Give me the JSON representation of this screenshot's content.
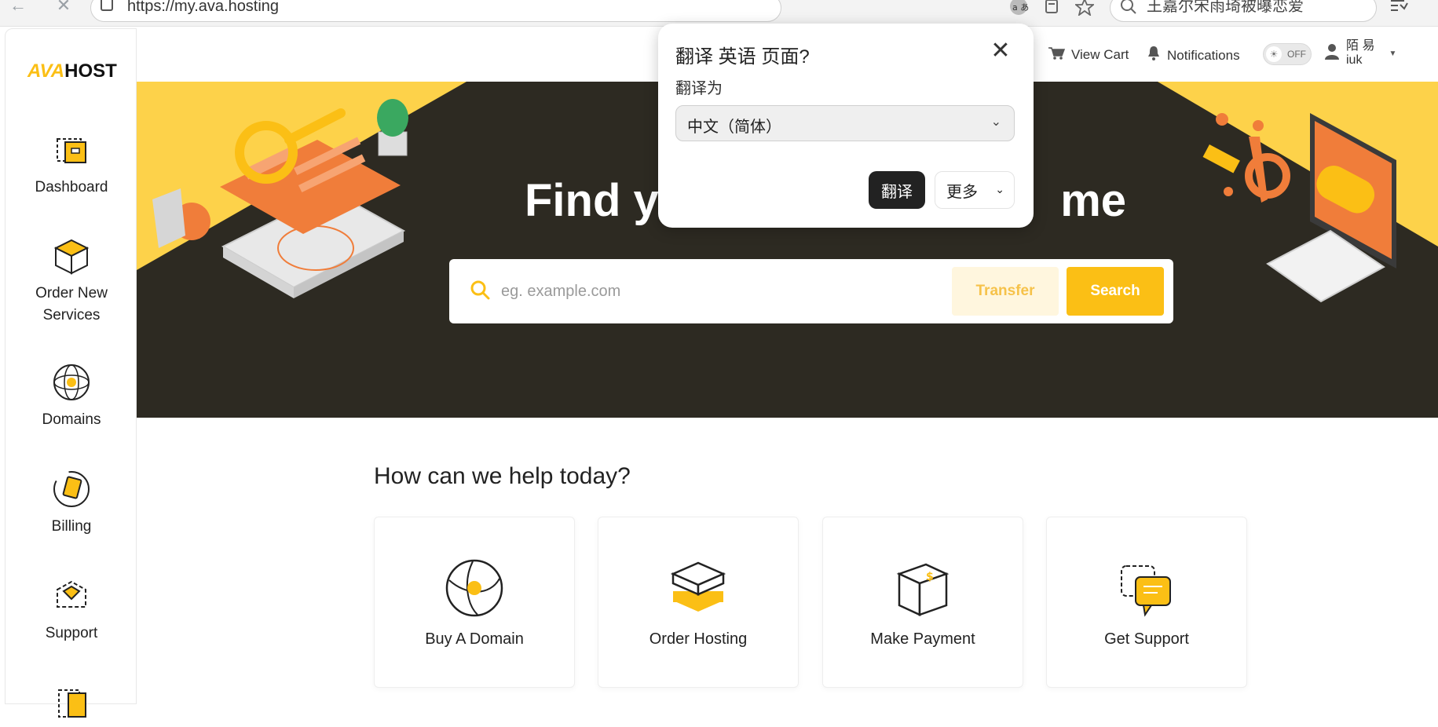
{
  "browser": {
    "url": "https://my.ava.hosting",
    "search_text": "王嘉尔宋雨琦被曝恋爱",
    "back_icon": "←",
    "stop_icon": "✕"
  },
  "logo": {
    "part1": "AVA",
    "part2": "HOST"
  },
  "sidebar": {
    "items": [
      {
        "label": "Dashboard",
        "icon": "dashboard-icon"
      },
      {
        "label": "Order New Services",
        "icon": "box-icon"
      },
      {
        "label": "Domains",
        "icon": "globe-icon"
      },
      {
        "label": "Billing",
        "icon": "billing-icon"
      },
      {
        "label": "Support",
        "icon": "support-icon"
      }
    ]
  },
  "topnav": {
    "view_cart": "View Cart",
    "notifications": "Notifications",
    "toggle_label": "OFF",
    "user_name": "陌 易",
    "user_sub": "iuk"
  },
  "hero": {
    "title_left": "Find yo",
    "title_right": "me",
    "search_placeholder": "eg. example.com",
    "transfer_label": "Transfer",
    "search_label": "Search"
  },
  "help": {
    "title": "How can we help today?",
    "cards": [
      {
        "label": "Buy A Domain"
      },
      {
        "label": "Order Hosting"
      },
      {
        "label": "Make Payment"
      },
      {
        "label": "Get Support"
      }
    ]
  },
  "translate_popup": {
    "title": "翻译 英语 页面?",
    "translate_to_label": "翻译为",
    "selected_language": "中文（简体）",
    "translate_button": "翻译",
    "more_button": "更多"
  },
  "colors": {
    "accent": "#fbbf15",
    "hero_dark": "#2d2a22",
    "orange": "#f07d3a"
  }
}
